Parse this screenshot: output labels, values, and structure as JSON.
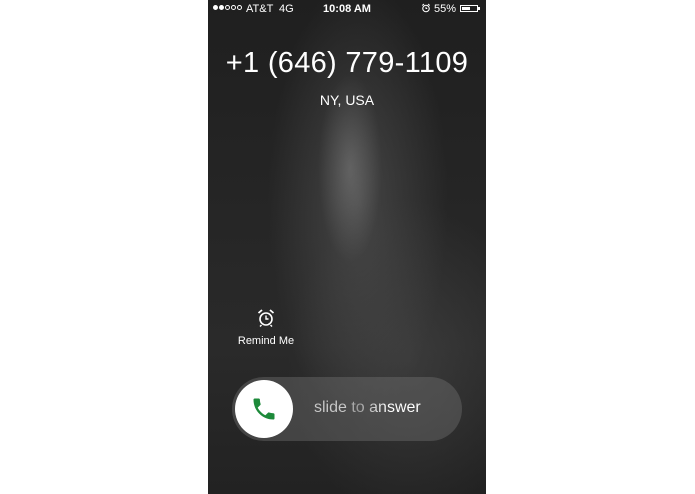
{
  "status_bar": {
    "signal_bars_filled": 2,
    "signal_bars_total": 5,
    "carrier": "AT&T",
    "network": "4G",
    "time": "10:08 AM",
    "alarm_icon": "alarm-clock-icon",
    "battery_percent_label": "55%",
    "battery_level": 0.55
  },
  "call": {
    "number": "+1 (646) 779-1109",
    "location": "NY, USA"
  },
  "actions": {
    "remind_label": "Remind Me",
    "remind_icon": "alarm-clock-icon"
  },
  "slider": {
    "label": "slide to answer",
    "knob_icon": "phone-handset-icon",
    "knob_icon_color": "#1d8a3a"
  },
  "colors": {
    "background": "#262626",
    "text": "#ffffff",
    "accept_green": "#1d8a3a"
  }
}
